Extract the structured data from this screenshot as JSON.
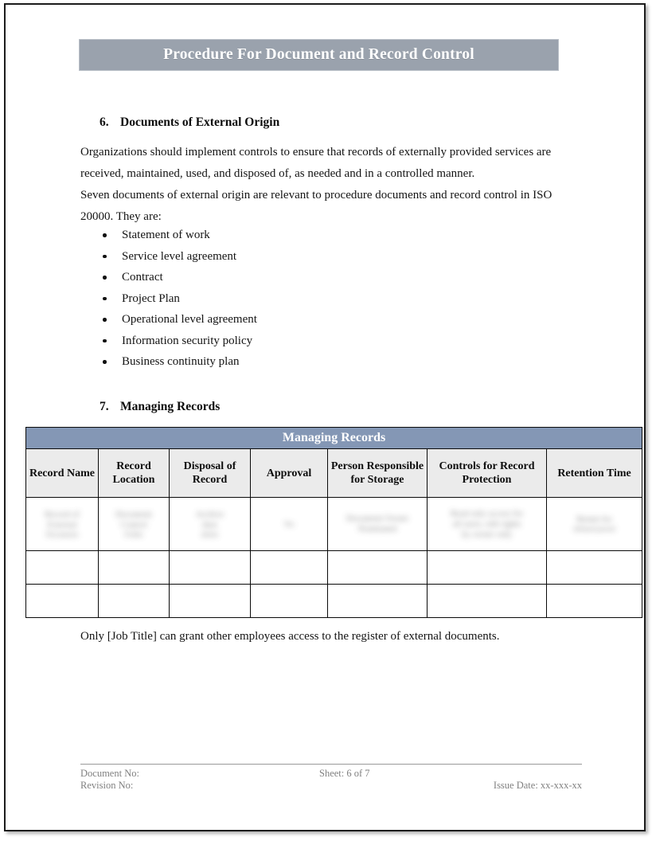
{
  "document": {
    "banner_title": "Procedure For Document and Record Control",
    "colors": {
      "banner_bg": "#9aa2ad",
      "table_title_bg": "#8497b5",
      "table_header_bg": "#ebebeb",
      "page_border": "#1c1c1c",
      "footer_text": "#808080"
    }
  },
  "sections": [
    {
      "number": "6.",
      "heading": "Documents of External Origin",
      "paragraphs": [
        "Organizations should implement controls to ensure that records of externally provided services are received, maintained, used, and disposed of, as needed and in a controlled manner.",
        "Seven documents of external origin are relevant to procedure documents and record control in ISO 20000. They are:"
      ],
      "bullets": [
        "Statement of work",
        "Service level agreement",
        "Contract",
        "Project Plan",
        "Operational level agreement",
        "Information security policy",
        "Business continuity plan"
      ]
    },
    {
      "number": "7.",
      "heading": "Managing Records"
    }
  ],
  "table": {
    "title": "Managing Records",
    "columns": [
      "Record Name",
      "Record Location",
      "Disposal of Record",
      "Approval",
      "Person Responsible for Storage",
      "Controls for Record Protection",
      "Retention Time"
    ],
    "rows": [
      {
        "redacted": true,
        "cells": [
          [
            "Record of",
            "External",
            "Documents"
          ],
          [
            "Document",
            "Control",
            "Folder"
          ],
          [
            "Archive",
            "then",
            "delete"
          ],
          [
            "Yes"
          ],
          [
            "Document Owner",
            "Nominated"
          ],
          [
            "Read only access for",
            "all users, edit rights",
            "by owner only"
          ],
          [
            "Retain for",
            "defined period"
          ]
        ]
      },
      {
        "redacted": false,
        "cells": [
          [],
          [],
          [],
          [],
          [],
          [],
          []
        ]
      },
      {
        "redacted": false,
        "cells": [
          [],
          [],
          [],
          [],
          [],
          [],
          []
        ]
      }
    ]
  },
  "closing_note": "Only [Job Title] can grant other employees access to the register of external documents.",
  "footer": {
    "document_no": "Document No:",
    "revision_no": "Revision No:",
    "sheet": "Sheet: 6 of 7",
    "issue_date": "Issue Date: xx-xxx-xx"
  }
}
